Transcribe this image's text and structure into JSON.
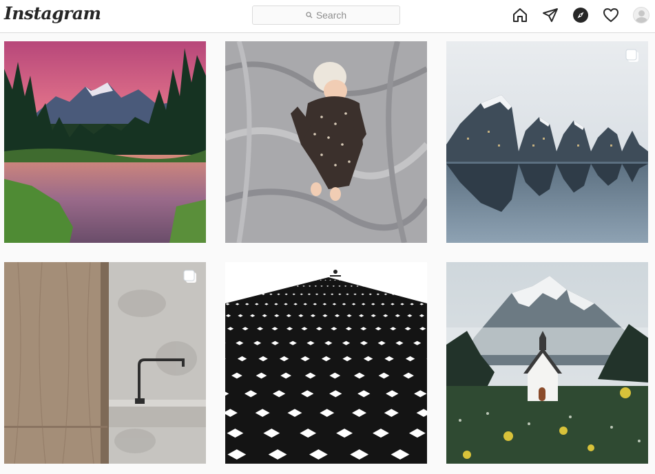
{
  "app": {
    "logo_text": "Instagram"
  },
  "search": {
    "placeholder": "Search"
  },
  "nav": {
    "items": [
      "home-icon",
      "direct-icon",
      "explore-icon",
      "activity-icon",
      "profile-avatar"
    ]
  },
  "posts": [
    {
      "subject": "mountain-sunset-lake",
      "multi": false
    },
    {
      "subject": "baby-on-blanket",
      "multi": false
    },
    {
      "subject": "wave-building-reflection",
      "multi": true
    },
    {
      "subject": "wood-and-marble-kitchen-faucet",
      "multi": true
    },
    {
      "subject": "cyclist-on-diamond-pattern",
      "multi": false
    },
    {
      "subject": "chapel-below-misty-mountain",
      "multi": false
    }
  ],
  "colors": {
    "background": "#fafafa",
    "header_bg": "#ffffff",
    "border": "#dbdbdb",
    "icon": "#262626",
    "muted_text": "#8e8e8e"
  }
}
